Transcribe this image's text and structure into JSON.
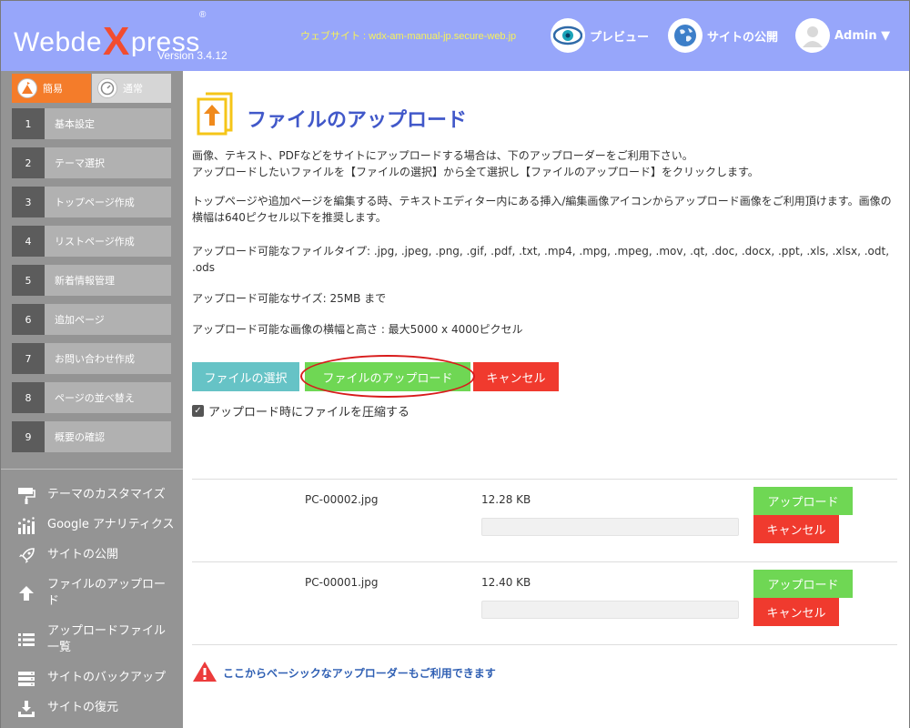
{
  "header": {
    "logo_pre": "Webde",
    "logo_x": "X",
    "logo_post": "press",
    "logo_reg": "®",
    "version": "Version 3.4.12",
    "website": "ウェブサイト : wdx-am-manual-jp.secure-web.jp",
    "preview_label": "プレビュー",
    "publish_label": "サイトの公開",
    "admin_label": "Admin ▼"
  },
  "sidebar": {
    "mode_easy": "簡易",
    "mode_normal": "通常",
    "steps": [
      {
        "num": "1",
        "label": "基本設定"
      },
      {
        "num": "2",
        "label": "テーマ選択"
      },
      {
        "num": "3",
        "label": "トップページ作成"
      },
      {
        "num": "4",
        "label": "リストページ作成"
      },
      {
        "num": "5",
        "label": "新着情報管理"
      },
      {
        "num": "6",
        "label": "追加ページ"
      },
      {
        "num": "7",
        "label": "お問い合わせ作成"
      },
      {
        "num": "8",
        "label": "ページの並べ替え"
      },
      {
        "num": "9",
        "label": "概要の確認"
      }
    ],
    "menu": [
      {
        "label": "テーマのカスタマイズ"
      },
      {
        "label": "Google アナリティクス"
      },
      {
        "label": "サイトの公開"
      },
      {
        "label": "ファイルのアップロード"
      },
      {
        "label": "アップロードファイル一覧"
      },
      {
        "label": "サイトのバックアップ"
      },
      {
        "label": "サイトの復元"
      }
    ]
  },
  "main": {
    "title": "ファイルのアップロード",
    "p1_line1": "画像、テキスト、PDFなどをサイトにアップロードする場合は、下のアップローダーをご利用下さい。",
    "p1_line2": "アップロードしたいファイルを【ファイルの選択】から全て選択し【ファイルのアップロード】をクリックします。",
    "p2": "トップページや追加ページを編集する時、テキストエディター内にある挿入/編集画像アイコンからアップロード画像をご利用頂けます。画像の横幅は640ピクセル以下を推奨します。",
    "p3": "アップロード可能なファイルタイプ: .jpg, .jpeg, .png, .gif, .pdf, .txt, .mp4, .mpg, .mpeg, .mov, .qt, .doc, .docx, .ppt, .xls, .xlsx, .odt, .ods",
    "p4": "アップロード可能なサイズ: 25MB まで",
    "p5": "アップロード可能な画像の横幅と高さ : 最大5000 x 4000ピクセル",
    "btn_select": "ファイルの選択",
    "btn_upload": "ファイルのアップロード",
    "btn_cancel": "キャンセル",
    "compress_label": "アップロード時にファイルを圧縮する",
    "files": [
      {
        "name": "PC-00002.jpg",
        "size": "12.28 KB",
        "upload": "アップロード",
        "cancel": "キャンセル",
        "progress": 0
      },
      {
        "name": "PC-00001.jpg",
        "size": "12.40 KB",
        "upload": "アップロード",
        "cancel": "キャンセル",
        "progress": 0
      }
    ],
    "basic_link": "ここからベーシックなアップローダーもご利用できます"
  },
  "colors": {
    "header_bg": "#97a6fa",
    "accent_orange": "#f47c2a",
    "title_blue": "#4158c9",
    "green": "#6fd754",
    "red": "#f03a2e",
    "teal": "#66c3c6"
  }
}
